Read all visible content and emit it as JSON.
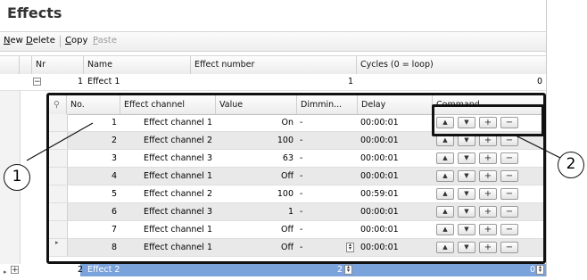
{
  "panel": {
    "title": "Effects"
  },
  "toolbar": {
    "new_label": "New",
    "delete_label": "Delete",
    "copy_label": "Copy",
    "paste_label": "Paste"
  },
  "outer_columns": {
    "nr": "Nr",
    "name": "Name",
    "effect_number": "Effect number",
    "cycles": "Cycles (0 = loop)"
  },
  "outer_rows": [
    {
      "nr": "1",
      "name": "Effect 1",
      "effect_number": "1",
      "cycles": "0"
    },
    {
      "nr": "2",
      "name": "Effect 2",
      "effect_number": "2",
      "cycles": "0"
    }
  ],
  "detail_columns": {
    "no": "No.",
    "channel": "Effect channel",
    "value": "Value",
    "dimming": "Dimmin...",
    "delay": "Delay",
    "command": "Command"
  },
  "detail_rows": [
    {
      "no": "1",
      "channel": "Effect channel 1",
      "value": "On",
      "dimming": "-",
      "delay": "00:00:01"
    },
    {
      "no": "2",
      "channel": "Effect channel 2",
      "value": "100",
      "dimming": "-",
      "delay": "00:00:01"
    },
    {
      "no": "3",
      "channel": "Effect channel 3",
      "value": "63",
      "dimming": "-",
      "delay": "00:00:01"
    },
    {
      "no": "4",
      "channel": "Effect channel 1",
      "value": "Off",
      "dimming": "-",
      "delay": "00:00:01"
    },
    {
      "no": "5",
      "channel": "Effect channel 2",
      "value": "100",
      "dimming": "-",
      "delay": "00:59:01"
    },
    {
      "no": "6",
      "channel": "Effect channel 3",
      "value": "1",
      "dimming": "-",
      "delay": "00:00:01"
    },
    {
      "no": "7",
      "channel": "Effect channel 1",
      "value": "Off",
      "dimming": "-",
      "delay": "00:00:01"
    },
    {
      "no": "8",
      "channel": "Effect channel 1",
      "value": "Off",
      "dimming": "-",
      "delay": "00:00:01"
    }
  ],
  "icons": {
    "move_up": "arrow-up-icon",
    "move_down": "arrow-down-icon",
    "add": "plus-icon",
    "remove": "minus-icon"
  },
  "callouts": {
    "one": "1",
    "two": "2"
  },
  "colors": {
    "selection": "#7aa2db",
    "row_alt": "#e9e9e9"
  }
}
